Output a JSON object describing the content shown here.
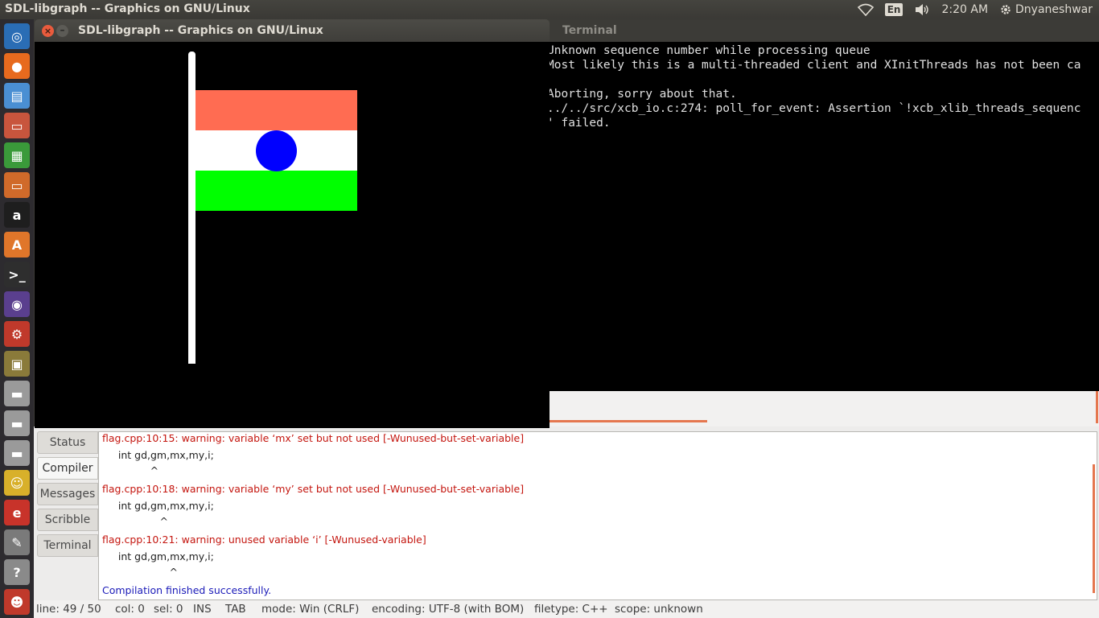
{
  "top_panel": {
    "title": "SDL-libgraph -- Graphics on GNU/Linux",
    "keyboard_layout": "En",
    "time": "2:20 AM",
    "user": "Dnyaneshwar"
  },
  "launcher": {
    "items": [
      {
        "name": "dash-home",
        "glyph": "◎",
        "color": "#2a6db5"
      },
      {
        "name": "firefox",
        "glyph": "●",
        "color": "#e76a1e"
      },
      {
        "name": "files",
        "glyph": "▤",
        "color": "#4a8fd3"
      },
      {
        "name": "file-manager",
        "glyph": "▭",
        "color": "#c8553d"
      },
      {
        "name": "libreoffice-calc",
        "glyph": "▦",
        "color": "#3a9a3a"
      },
      {
        "name": "libreoffice-impress",
        "glyph": "▭",
        "color": "#d06a2a"
      },
      {
        "name": "amazon",
        "glyph": "a",
        "color": "#1e1e1e"
      },
      {
        "name": "software-center",
        "glyph": "A",
        "color": "#e0762a"
      },
      {
        "name": "terminal",
        "glyph": ">_",
        "color": "#2e2e2e"
      },
      {
        "name": "eclipse",
        "glyph": "◉",
        "color": "#5a3f8e"
      },
      {
        "name": "settings",
        "glyph": "⚙",
        "color": "#c0392b"
      },
      {
        "name": "dosbox",
        "glyph": "▣",
        "color": "#8a7a3a"
      },
      {
        "name": "drive-1",
        "glyph": "▬",
        "color": "#9a9a9a"
      },
      {
        "name": "drive-2",
        "glyph": "▬",
        "color": "#9a9a9a"
      },
      {
        "name": "drive-3",
        "glyph": "▬",
        "color": "#9a9a9a"
      },
      {
        "name": "pidgin",
        "glyph": "☺",
        "color": "#d8b02a"
      },
      {
        "name": "app-red",
        "glyph": "e",
        "color": "#c8332a"
      },
      {
        "name": "text-editor",
        "glyph": "✎",
        "color": "#7a7a7a"
      },
      {
        "name": "help",
        "glyph": "?",
        "color": "#8a8a8a"
      },
      {
        "name": "app-bottom",
        "glyph": "☻",
        "color": "#c0392b"
      }
    ]
  },
  "terminal": {
    "title": "Terminal",
    "lines": [
      "Unknown sequence number while processing queue",
      "Most likely this is a multi-threaded client and XInitThreads has not been ca",
      "",
      "Aborting, sorry about that.",
      "../../src/xcb_io.c:274: poll_for_event: Assertion `!xcb_xlib_threads_sequenc",
      "' failed."
    ]
  },
  "sdl_window": {
    "title": "SDL-libgraph -- Graphics on GNU/Linux",
    "close_glyph": "×",
    "minimize_glyph": "–",
    "flag_colors": {
      "saffron": "#ff6c52",
      "white": "#ffffff",
      "green": "#00ff00",
      "chakra": "#0000ff"
    }
  },
  "message_panel": {
    "tabs": [
      "Status",
      "Compiler",
      "Messages",
      "Scribble",
      "Terminal"
    ],
    "active_tab": "Compiler",
    "output": [
      {
        "text": "flag.cpp:10:15: warning: variable ‘mx’ set but not used [-Wunused-but-set-variable]",
        "kind": "red"
      },
      {
        "text": "     int gd,gm,mx,my,i;",
        "kind": "dark"
      },
      {
        "text": "               ^",
        "kind": "dark"
      },
      {
        "text": "flag.cpp:10:18: warning: variable ‘my’ set but not used [-Wunused-but-set-variable]",
        "kind": "red"
      },
      {
        "text": "     int gd,gm,mx,my,i;",
        "kind": "dark"
      },
      {
        "text": "                  ^",
        "kind": "dark"
      },
      {
        "text": "flag.cpp:10:21: warning: unused variable ‘i’ [-Wunused-variable]",
        "kind": "red"
      },
      {
        "text": "     int gd,gm,mx,my,i;",
        "kind": "dark"
      },
      {
        "text": "                     ^",
        "kind": "dark"
      },
      {
        "text": "Compilation finished successfully.",
        "kind": "blue"
      }
    ]
  },
  "statusbar": {
    "line": "line: 49 / 50",
    "col": "col: 0",
    "sel": "sel: 0",
    "ins": "INS",
    "tab": "TAB",
    "mode": "mode: Win (CRLF)",
    "encoding": "encoding: UTF-8 (with BOM)",
    "filetype": "filetype: C++",
    "scope": "scope: unknown"
  }
}
